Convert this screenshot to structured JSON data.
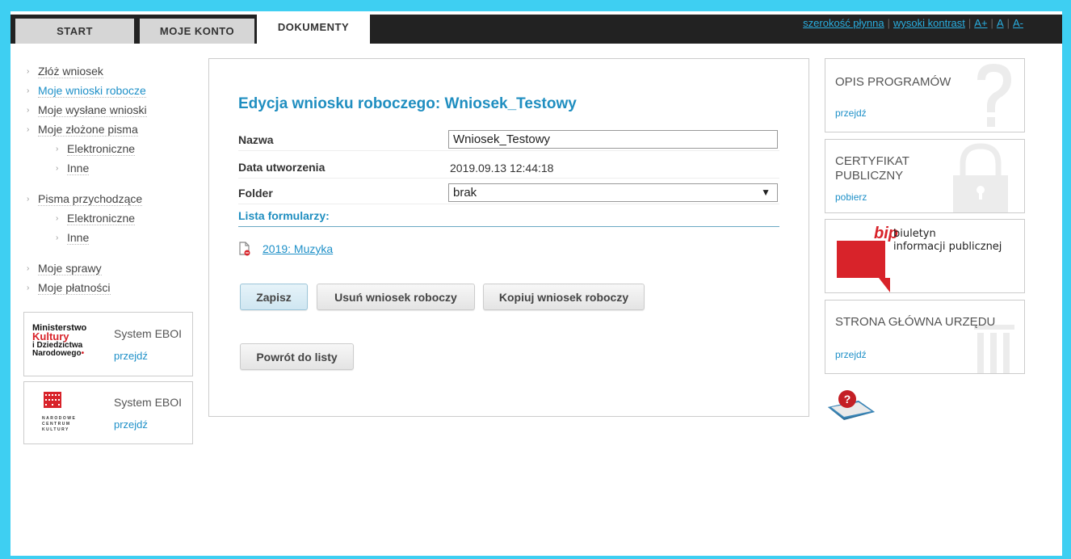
{
  "tabs": [
    {
      "label": "START"
    },
    {
      "label": "MOJE KONTO"
    },
    {
      "label": "DOKUMENTY"
    }
  ],
  "toplinks": {
    "fluid": "szerokość płynna",
    "contrast": "wysoki kontrast",
    "font_up": "A+",
    "font_norm": "A",
    "font_down": "A-"
  },
  "leftnav": {
    "items": [
      {
        "label": "Złóż wniosek"
      },
      {
        "label": "Moje wnioski robocze"
      },
      {
        "label": "Moje wysłane wnioski"
      },
      {
        "label": "Moje złożone pisma"
      },
      {
        "label": "Elektroniczne"
      },
      {
        "label": "Inne"
      },
      {
        "label": "Pisma przychodzące"
      },
      {
        "label": "Elektroniczne"
      },
      {
        "label": "Inne"
      },
      {
        "label": "Moje sprawy"
      },
      {
        "label": "Moje płatności"
      }
    ]
  },
  "logos": {
    "mkidn": {
      "line1": "Ministerstwo",
      "line2": "Kultury",
      "line3": "i Dziedzictwa",
      "line4": "Narodowego",
      "system": "System EBOI",
      "link": "przejdź"
    },
    "nck": {
      "line1": "NARODOWE",
      "line2": "CENTRUM",
      "line3": "KULTURY",
      "system": "System EBOI",
      "link": "przejdź"
    }
  },
  "main": {
    "title": "Edycja wniosku roboczego: Wniosek_Testowy",
    "name_label": "Nazwa",
    "name_value": "Wniosek_Testowy",
    "date_label": "Data utworzenia",
    "date_value": "2019.09.13 12:44:18",
    "folder_label": "Folder",
    "folder_value": "brak",
    "forms_header": "Lista formularzy:",
    "form_link": "2019: Muzyka",
    "save": "Zapisz",
    "delete": "Usuń wniosek roboczy",
    "copy": "Kopiuj wniosek roboczy",
    "back": "Powrót do listy"
  },
  "right": {
    "programs_title": "OPIS PROGRAMÓW",
    "programs_link": "przejdź",
    "cert_title1": "CERTYFIKAT",
    "cert_title2": "PUBLICZNY",
    "cert_link": "pobierz",
    "bip_logo": "bip",
    "bip_line1": "biuletyn",
    "bip_line2": "informacji publicznej",
    "home_title": "STRONA GŁÓWNA URZĘDU",
    "home_link": "przejdź"
  },
  "colors": {
    "accent": "#1f8ec0",
    "border": "#3ecff2",
    "topbar": "#222222",
    "bip_red": "#d8232a"
  }
}
